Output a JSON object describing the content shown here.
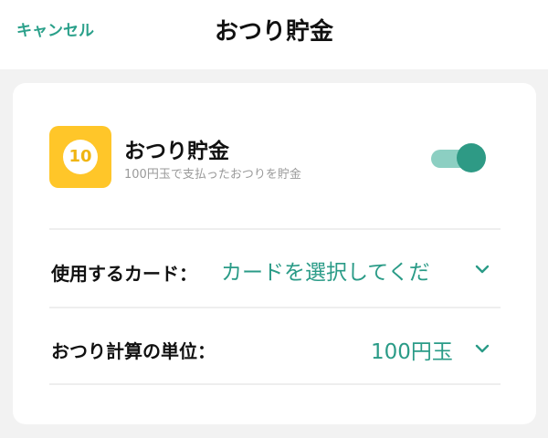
{
  "header": {
    "cancel_label": "キャンセル",
    "title": "おつり貯金"
  },
  "feature": {
    "icon_text": "10",
    "title": "おつり貯金",
    "description": "100円玉で支払ったおつりを貯金",
    "toggle_on": true
  },
  "rows": {
    "card": {
      "label": "使用するカード：",
      "value": "カードを選択してくだ"
    },
    "unit": {
      "label": "おつり計算の単位：",
      "value": "100円玉"
    }
  },
  "colors": {
    "accent": "#2aa08a",
    "icon_bg": "#ffc629",
    "toggle_track": "#8ccfc2",
    "toggle_knob": "#2e9a85"
  },
  "icons": {
    "chevron": "chevron-down-icon",
    "coin": "coin-icon"
  }
}
